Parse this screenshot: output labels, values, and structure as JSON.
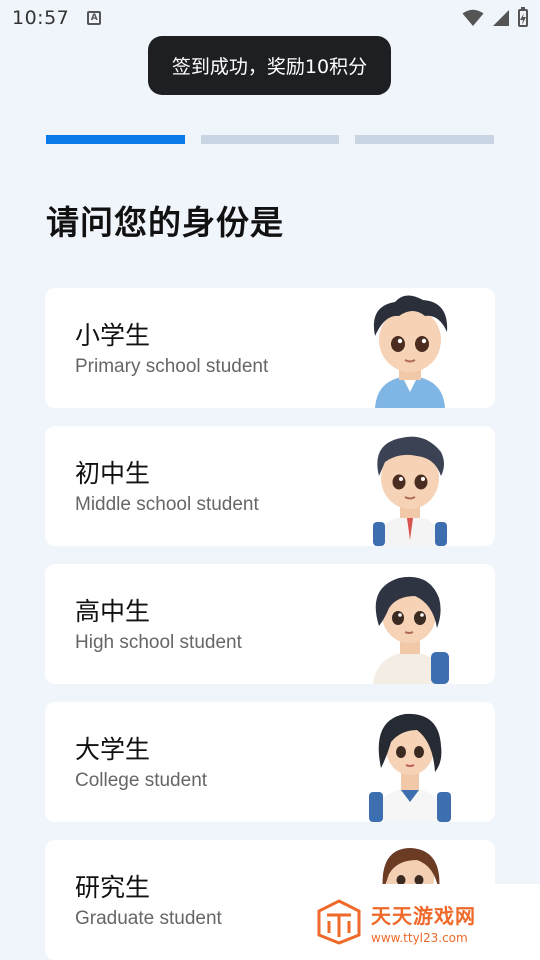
{
  "status_bar": {
    "time": "10:57",
    "notification_letter": "A",
    "icons": [
      "wifi-icon",
      "signal-icon",
      "battery-charging-icon"
    ]
  },
  "toast": {
    "message": "签到成功，奖励10积分"
  },
  "progress": {
    "total_steps": 3,
    "current_step": 1,
    "active_color": "#0b7bea",
    "inactive_color": "#c9d5e2"
  },
  "page": {
    "title": "请问您的身份是"
  },
  "options": [
    {
      "title": "小学生",
      "subtitle": "Primary school student",
      "avatar": "primary-student-avatar"
    },
    {
      "title": "初中生",
      "subtitle": "Middle school student",
      "avatar": "middle-student-avatar"
    },
    {
      "title": "高中生",
      "subtitle": "High school student",
      "avatar": "high-school-student-avatar"
    },
    {
      "title": "大学生",
      "subtitle": "College student",
      "avatar": "college-student-avatar"
    },
    {
      "title": "研究生",
      "subtitle": "Graduate student",
      "avatar": "graduate-student-avatar"
    }
  ],
  "watermark": {
    "name": "天天游戏网",
    "url": "www.ttyl23.com",
    "color": "#ef6a2a"
  }
}
